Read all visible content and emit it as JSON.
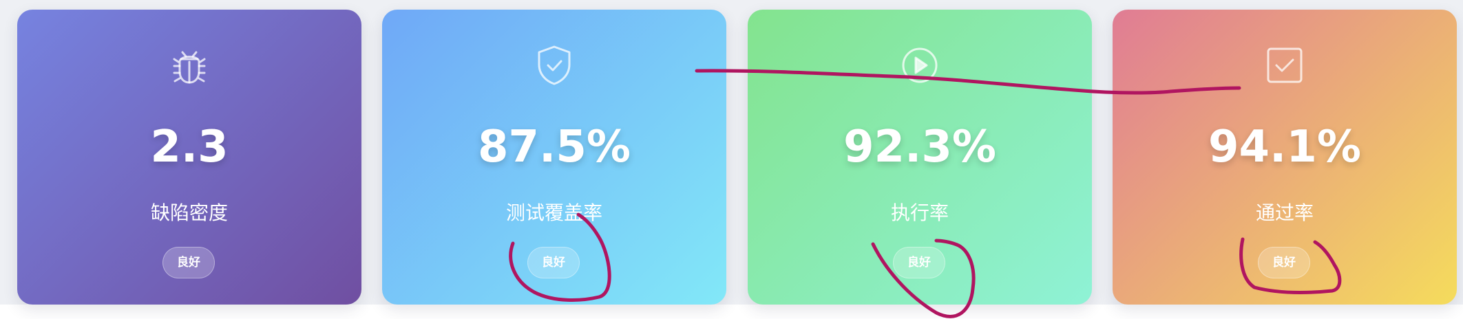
{
  "metrics": [
    {
      "value": "2.3",
      "label": "缺陷密度",
      "badge": "良好",
      "icon": "bug-icon",
      "gradient": [
        "#7683e0",
        "#704fa1"
      ]
    },
    {
      "value": "87.5%",
      "label": "测试覆盖率",
      "badge": "良好",
      "icon": "shield-check-icon",
      "gradient": [
        "#6fa8f7",
        "#82e8f8"
      ]
    },
    {
      "value": "92.3%",
      "label": "执行率",
      "badge": "良好",
      "icon": "play-circle-icon",
      "gradient": [
        "#83e38e",
        "#8ff2d6"
      ]
    },
    {
      "value": "94.1%",
      "label": "通过率",
      "badge": "良好",
      "icon": "checkbox-icon",
      "gradient": [
        "#e07c94",
        "#f5dc5c"
      ]
    }
  ],
  "annotation_color": "#b01560"
}
